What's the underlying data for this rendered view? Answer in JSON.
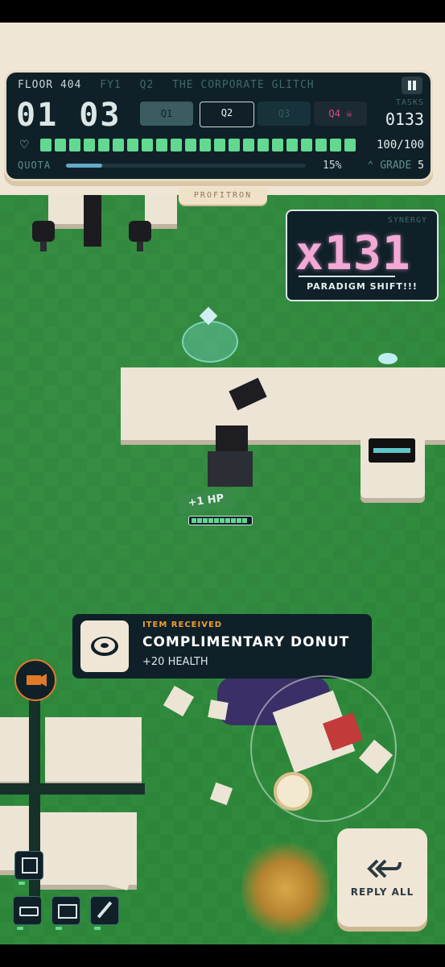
{
  "hud": {
    "floor": "FLOOR 404",
    "fiscal_year": "FY1",
    "quarter": "Q2",
    "title": "THE CORPORATE GLITCH",
    "timer": "01 03",
    "quarters": [
      {
        "label": "Q1",
        "state": "done"
      },
      {
        "label": "Q2",
        "state": "current"
      },
      {
        "label": "Q3",
        "state": "upcoming"
      },
      {
        "label": "Q4 ☠",
        "state": "boss"
      }
    ],
    "tasks_label": "TASKS",
    "tasks_value": "0133",
    "health_text": "100/100",
    "health_fraction": 1.0,
    "health_segments": 22,
    "quota_label": "QUOTA",
    "quota_percent": "15%",
    "quota_fraction": 0.15,
    "grade_label": "GRADE",
    "grade_value": "5",
    "brand": "PROFITRON"
  },
  "synergy": {
    "label": "SYNERGY",
    "value": "x131",
    "subtitle": "PARADIGM SHIFT!!!"
  },
  "player": {
    "hp_popup": "+1 HP",
    "health_fraction": 1.0
  },
  "toast": {
    "label": "ITEM RECEIVED",
    "title": "COMPLIMENTARY DONUT",
    "subtitle": "+20 HEALTH",
    "icon": "donut-icon"
  },
  "controls": {
    "reply_all_label": "REPLY ALL",
    "reply_all_icon": "reply-all-icon",
    "camera_icon": "camera-icon",
    "tools": [
      "image-icon",
      "stapler-icon",
      "mail-icon",
      "pen-icon"
    ]
  },
  "colors": {
    "floor_green": "#2f8a3c",
    "hud_bg": "#0f2028",
    "health_green": "#63d890",
    "synergy_pink": "#f2a9d6",
    "toast_label_orange": "#f0a030",
    "cream": "#f0e6d6"
  }
}
